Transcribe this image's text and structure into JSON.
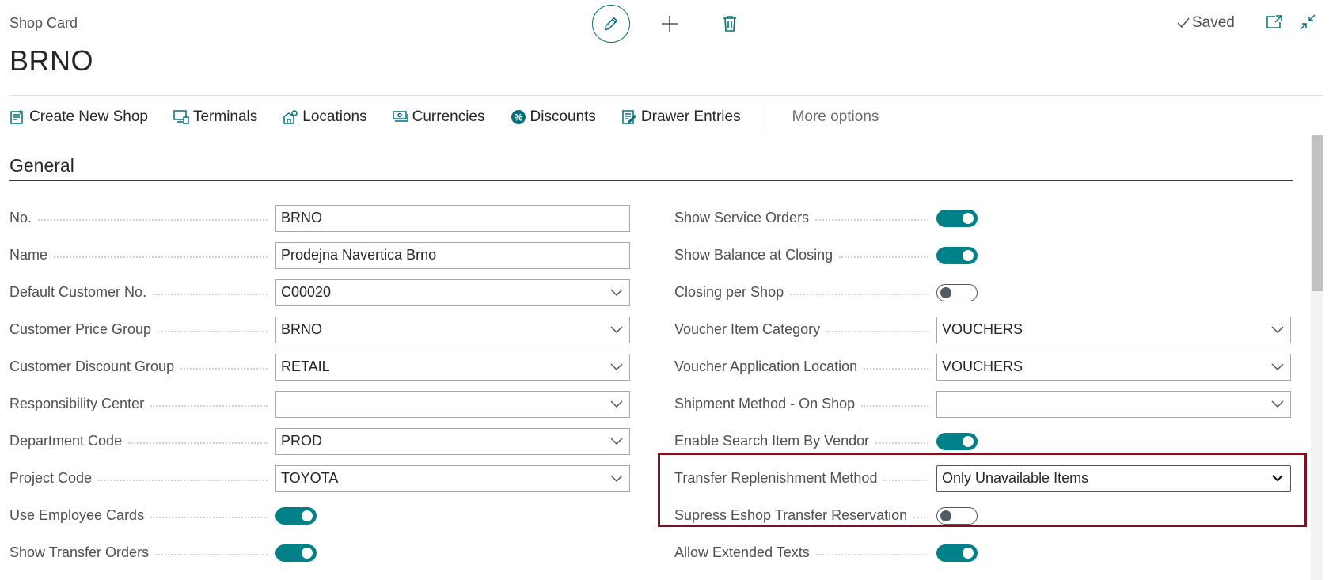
{
  "page": {
    "caption": "Shop Card",
    "title": "BRNO",
    "status": "Saved"
  },
  "actions": [
    {
      "label": "Create New Shop",
      "icon": "create-shop-icon"
    },
    {
      "label": "Terminals",
      "icon": "terminal-icon"
    },
    {
      "label": "Locations",
      "icon": "location-icon"
    },
    {
      "label": "Currencies",
      "icon": "currency-icon"
    },
    {
      "label": "Discounts",
      "icon": "discount-icon"
    },
    {
      "label": "Drawer Entries",
      "icon": "drawer-entries-icon"
    }
  ],
  "more_options": "More options",
  "section": {
    "title": "General"
  },
  "left_fields": {
    "no": {
      "label": "No.",
      "value": "BRNO"
    },
    "name": {
      "label": "Name",
      "value": "Prodejna Navertica Brno"
    },
    "default_customer": {
      "label": "Default Customer No.",
      "value": "C00020"
    },
    "price_group": {
      "label": "Customer Price Group",
      "value": "BRNO"
    },
    "discount_group": {
      "label": "Customer Discount Group",
      "value": "RETAIL"
    },
    "responsibility": {
      "label": "Responsibility Center",
      "value": ""
    },
    "department": {
      "label": "Department Code",
      "value": "PROD"
    },
    "project": {
      "label": "Project Code",
      "value": "TOYOTA"
    },
    "employee_cards": {
      "label": "Use Employee Cards",
      "state": "on"
    },
    "transfer_orders": {
      "label": "Show Transfer Orders",
      "state": "on"
    }
  },
  "right_fields": {
    "service_orders": {
      "label": "Show Service Orders",
      "state": "on"
    },
    "balance_closing": {
      "label": "Show Balance at Closing",
      "state": "on"
    },
    "closing_per_shop": {
      "label": "Closing per Shop",
      "state": "off"
    },
    "voucher_category": {
      "label": "Voucher Item Category",
      "value": "VOUCHERS"
    },
    "voucher_location": {
      "label": "Voucher Application Location",
      "value": "VOUCHERS"
    },
    "shipment_method": {
      "label": "Shipment Method - On Shop",
      "value": ""
    },
    "search_by_vendor": {
      "label": "Enable Search Item By Vendor",
      "state": "on"
    },
    "replenishment": {
      "label": "Transfer Replenishment Method",
      "value": "Only Unavailable Items"
    },
    "eshop_reservation": {
      "label": "Supress Eshop Transfer Reservation",
      "state": "off"
    },
    "extended_texts": {
      "label": "Allow Extended Texts",
      "state": "on"
    }
  },
  "colors": {
    "accent": "#00818a",
    "highlight": "#7d1220"
  }
}
